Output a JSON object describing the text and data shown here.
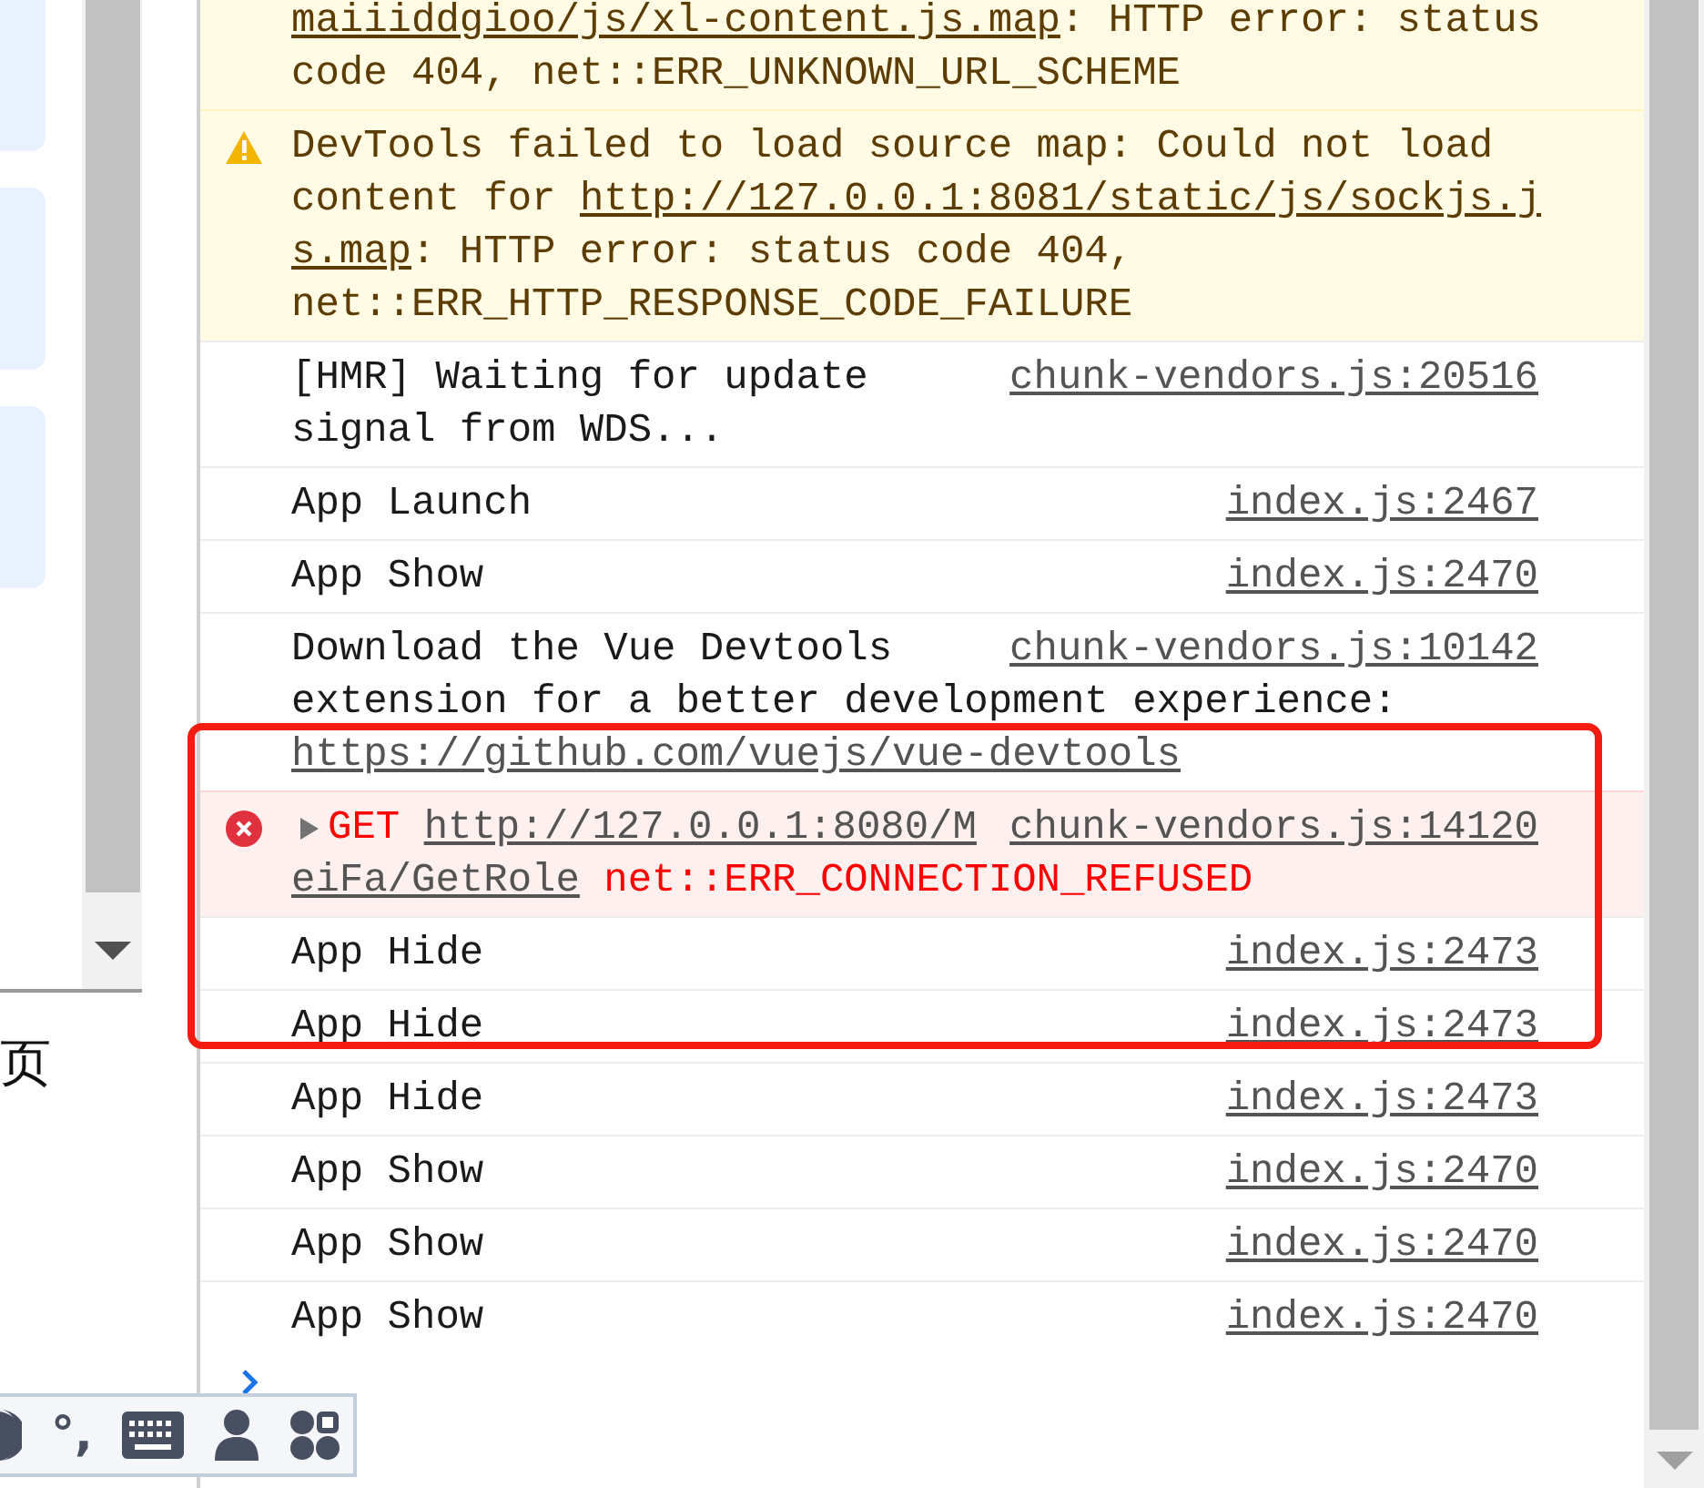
{
  "left_panel": {
    "partial_label": "页"
  },
  "console": {
    "rows": [
      {
        "kind": "warning",
        "icon": false,
        "lines": [
          [
            {
              "kind": "link",
              "text": "maiiiddgioo/js/xl-content.js.map"
            },
            {
              "kind": "text",
              "text": ": HTTP error: status"
            }
          ],
          [
            {
              "kind": "text",
              "text": "code 404, net::ERR_UNKNOWN_URL_SCHEME"
            }
          ]
        ]
      },
      {
        "kind": "warning",
        "icon": true,
        "lines": [
          [
            {
              "kind": "text",
              "text": "DevTools failed to load source map: Could not load"
            }
          ],
          [
            {
              "kind": "text",
              "text": "content for "
            },
            {
              "kind": "link",
              "text": "http://127.0.0.1:8081/static/js/sockjs.j"
            }
          ],
          [
            {
              "kind": "link",
              "text": "s.map"
            },
            {
              "kind": "text",
              "text": ": HTTP error: status code 404,"
            }
          ],
          [
            {
              "kind": "text",
              "text": "net::ERR_HTTP_RESPONSE_CODE_FAILURE"
            }
          ]
        ]
      },
      {
        "kind": "log",
        "source": "chunk-vendors.js:20516",
        "lines": [
          [
            {
              "kind": "text",
              "text": "[HMR] Waiting for update"
            }
          ],
          [
            {
              "kind": "text",
              "text": "signal from WDS..."
            }
          ]
        ]
      },
      {
        "kind": "log",
        "source": "index.js:2467",
        "lines": [
          [
            {
              "kind": "text",
              "text": "App Launch"
            }
          ]
        ]
      },
      {
        "kind": "log",
        "source": "index.js:2470",
        "lines": [
          [
            {
              "kind": "text",
              "text": "App Show"
            }
          ]
        ]
      },
      {
        "kind": "log",
        "source": "chunk-vendors.js:10142",
        "lines": [
          [
            {
              "kind": "text",
              "text": "Download the Vue Devtools"
            }
          ],
          [
            {
              "kind": "text",
              "text": "extension for a better development experience:"
            }
          ],
          [
            {
              "kind": "link",
              "text": "https://github.com/vuejs/vue-devtools"
            }
          ]
        ]
      },
      {
        "kind": "error",
        "icon": true,
        "expandable": true,
        "source": "chunk-vendors.js:14120",
        "lines": [
          [
            {
              "kind": "text",
              "text": "GET "
            },
            {
              "kind": "link",
              "text": "http://127.0.0.1:8080/M"
            }
          ],
          [
            {
              "kind": "link",
              "text": "eiFa/GetRole"
            },
            {
              "kind": "text",
              "text": " net::ERR_CONNECTION_REFUSED"
            }
          ]
        ]
      },
      {
        "kind": "log",
        "source": "index.js:2473",
        "lines": [
          [
            {
              "kind": "text",
              "text": "App Hide"
            }
          ]
        ]
      },
      {
        "kind": "log",
        "source": "index.js:2473",
        "lines": [
          [
            {
              "kind": "text",
              "text": "App Hide"
            }
          ]
        ]
      },
      {
        "kind": "log",
        "source": "index.js:2473",
        "lines": [
          [
            {
              "kind": "text",
              "text": "App Hide"
            }
          ]
        ]
      },
      {
        "kind": "log",
        "source": "index.js:2470",
        "lines": [
          [
            {
              "kind": "text",
              "text": "App Show"
            }
          ]
        ]
      },
      {
        "kind": "log",
        "source": "index.js:2470",
        "lines": [
          [
            {
              "kind": "text",
              "text": "App Show"
            }
          ]
        ]
      },
      {
        "kind": "log",
        "source": "index.js:2470",
        "lines": [
          [
            {
              "kind": "text",
              "text": "App Show"
            }
          ]
        ]
      }
    ]
  },
  "ime_toolbar": {
    "punctuation": "°,"
  }
}
